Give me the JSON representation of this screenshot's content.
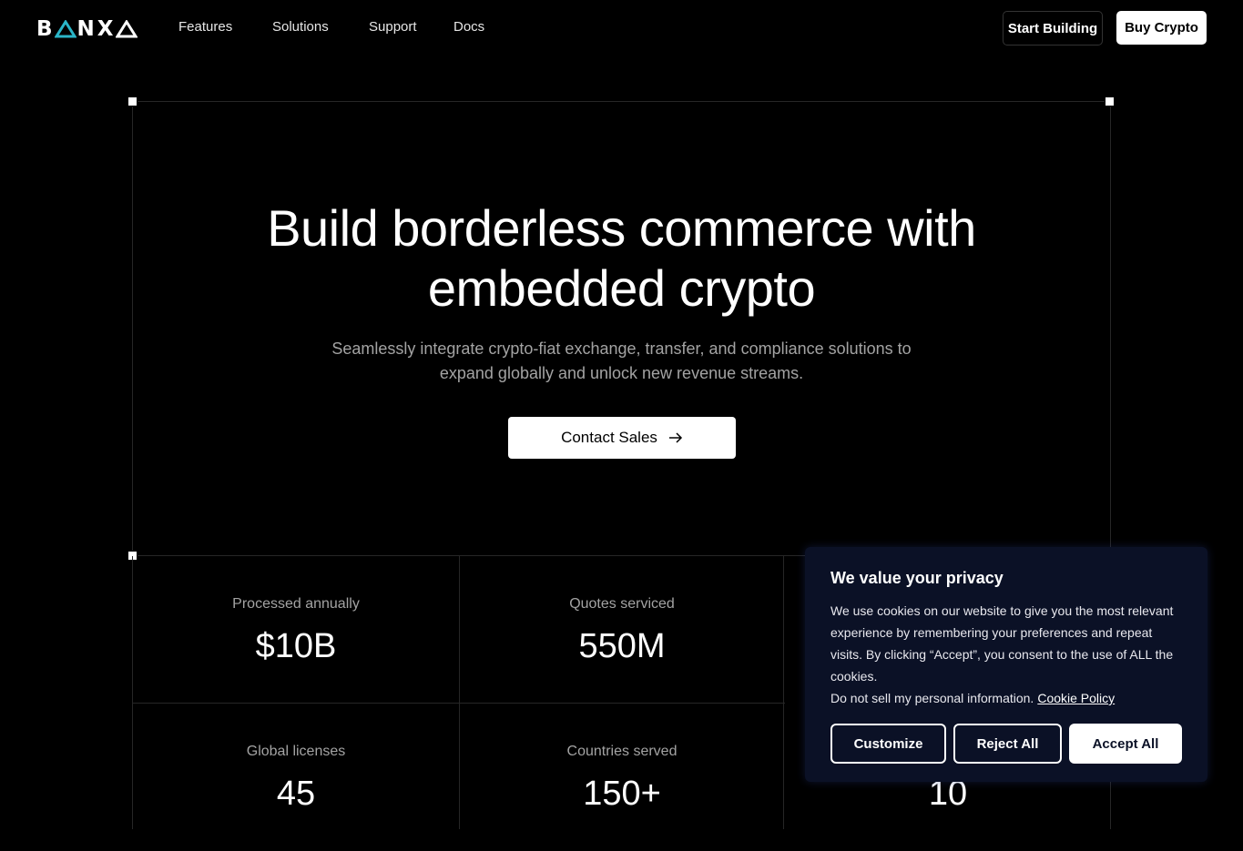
{
  "header": {
    "logo_text": [
      "B",
      "N",
      "X"
    ],
    "logo_accent_color": "#2ab5c8",
    "nav": [
      "Features",
      "Solutions",
      "Support",
      "Docs"
    ],
    "start_building": "Start Building",
    "buy_crypto": "Buy Crypto"
  },
  "hero": {
    "title_line1": "Build borderless commerce with",
    "title_line2": "embedded crypto",
    "subtitle_line1": "Seamlessly integrate crypto-fiat exchange, transfer, and compliance solutions to",
    "subtitle_line2": "expand globally and unlock new revenue streams.",
    "cta": "Contact Sales"
  },
  "stats": [
    {
      "label": "Processed annually",
      "value": "$10B"
    },
    {
      "label": "Quotes serviced",
      "value": "550M"
    },
    {
      "label": "Global licenses",
      "value": "45"
    },
    {
      "label": "Countries served",
      "value": "150+"
    },
    {
      "value": "10"
    }
  ],
  "cookie": {
    "title": "We value your privacy",
    "body": "We use cookies on our website to give you the most relevant experience by remembering your preferences and repeat visits. By clicking “Accept”, you consent to the use of ALL the cookies.",
    "do_not_sell": "Do not sell my personal information.",
    "policy_link": "Cookie Policy",
    "customize": "Customize",
    "reject": "Reject All",
    "accept": "Accept All"
  }
}
